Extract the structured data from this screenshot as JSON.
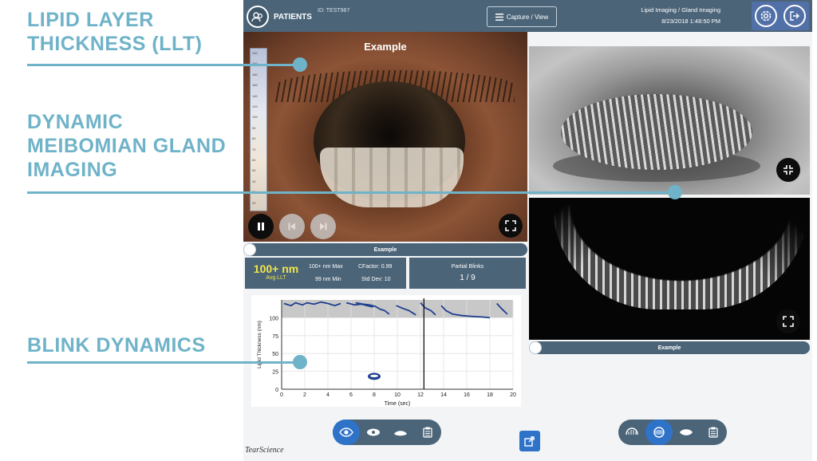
{
  "callouts": {
    "llt_line1": "LIPID LAYER",
    "llt_line2": "THICKNESS (LLT)",
    "mg_line1": "DYNAMIC",
    "mg_line2": "MEIBOMIAN GLAND",
    "mg_line3": "IMAGING",
    "blink": "BLINK DYNAMICS"
  },
  "topbar": {
    "patients_label": "PATIENTS",
    "patient_id": "ID: TEST987",
    "capture_view_label": "Capture / View",
    "mode": "Lipid Imaging / Gland Imaging",
    "datetime": "8/23/2018  1:48:50 PM"
  },
  "eye_panel": {
    "title": "Example",
    "scale_ticks": [
      "240",
      "200",
      "180",
      "160",
      "140",
      "120",
      "100",
      "90",
      "80",
      "70",
      "60",
      "50",
      "40",
      "30",
      "20"
    ]
  },
  "labels": {
    "lipid_bar": "Example",
    "mg_bar": "Example"
  },
  "stats": {
    "avg_value": "100+ nm",
    "avg_label": "Avg LLT",
    "max_text": "100+ nm Max",
    "cfactor_text": "CFactor: 0.99",
    "min_text": "99 nm Min",
    "stddev_text": "Std Dev: 10",
    "partial_blinks_label": "Partial Blinks",
    "partial_blinks_value": "1 / 9"
  },
  "chart_data": {
    "type": "line",
    "xlabel": "Time (sec)",
    "ylabel": "Lipid Thickness (nm)",
    "xlim": [
      0,
      20
    ],
    "ylim": [
      0,
      125
    ],
    "xticks": [
      "0",
      "2",
      "4",
      "6",
      "8",
      "10",
      "12",
      "14",
      "16",
      "18",
      "20"
    ],
    "yticks": [
      "0",
      "25",
      "50",
      "75",
      "100"
    ],
    "shaded_band": [
      100,
      125
    ],
    "marker_x": 12.3,
    "blink_marker": {
      "x": 8,
      "y": 18
    },
    "series": [
      {
        "values": [
          [
            0.2,
            120
          ],
          [
            0.8,
            117
          ],
          [
            1.2,
            121
          ],
          [
            1.8,
            118
          ],
          [
            2.2,
            121
          ],
          [
            2.8,
            119
          ],
          [
            3.4,
            122
          ],
          [
            4.0,
            120
          ],
          [
            4.6,
            117
          ],
          [
            5.1,
            120
          ]
        ]
      },
      {
        "values": [
          [
            5.6,
            121
          ],
          [
            6.3,
            118
          ],
          [
            6.9,
            119
          ],
          [
            7.4,
            117
          ],
          [
            7.9,
            115
          ]
        ]
      },
      {
        "values": [
          [
            6.4,
            121
          ],
          [
            7.1,
            119
          ],
          [
            7.6,
            118
          ],
          [
            8.1,
            116
          ],
          [
            8.5,
            112
          ],
          [
            8.9,
            110
          ],
          [
            9.3,
            105
          ]
        ]
      },
      {
        "values": [
          [
            9.9,
            117
          ],
          [
            10.5,
            113
          ],
          [
            11.0,
            110
          ],
          [
            11.6,
            104
          ]
        ]
      },
      {
        "values": [
          [
            12.0,
            121
          ],
          [
            12.4,
            114
          ],
          [
            12.9,
            110
          ],
          [
            13.3,
            104
          ]
        ]
      },
      {
        "values": [
          [
            13.8,
            117
          ],
          [
            14.2,
            110
          ],
          [
            14.8,
            105
          ],
          [
            15.6,
            103
          ],
          [
            16.4,
            102
          ],
          [
            17.4,
            101
          ],
          [
            18.0,
            100
          ]
        ]
      },
      {
        "values": [
          [
            18.6,
            120
          ],
          [
            19.0,
            113
          ],
          [
            19.5,
            105
          ]
        ]
      }
    ]
  },
  "brand": "TearScience",
  "icons": {
    "patients": "patients-icon",
    "settings": "gear-icon",
    "logout": "logout-icon",
    "capture": "menu-icon"
  }
}
